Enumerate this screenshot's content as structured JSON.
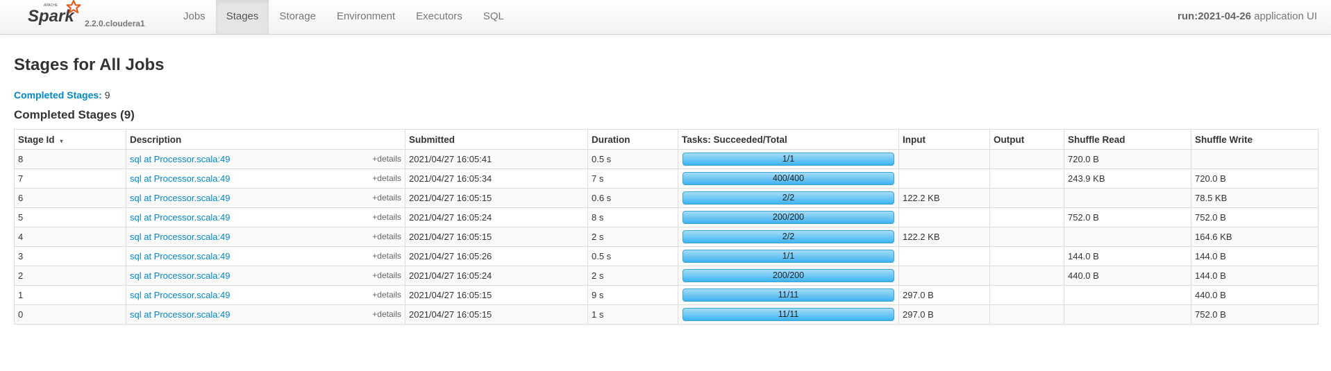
{
  "brand": {
    "logo_text": "Spark",
    "logo_small_text": "APACHE",
    "version": "2.2.0.cloudera1"
  },
  "nav": {
    "tabs": [
      {
        "label": "Jobs",
        "active": false
      },
      {
        "label": "Stages",
        "active": true
      },
      {
        "label": "Storage",
        "active": false
      },
      {
        "label": "Environment",
        "active": false
      },
      {
        "label": "Executors",
        "active": false
      },
      {
        "label": "SQL",
        "active": false
      }
    ]
  },
  "app": {
    "name": "run:2021-04-26",
    "suffix": "application UI"
  },
  "page": {
    "title": "Stages for All Jobs",
    "summary_label": "Completed Stages:",
    "summary_value": "9",
    "section_title": "Completed Stages (9)"
  },
  "table": {
    "columns": [
      "Stage Id",
      "Description",
      "Submitted",
      "Duration",
      "Tasks: Succeeded/Total",
      "Input",
      "Output",
      "Shuffle Read",
      "Shuffle Write"
    ],
    "sort_indicator": "▾",
    "details_label": "+details",
    "rows": [
      {
        "id": "8",
        "desc": "sql at Processor.scala:49",
        "submitted": "2021/04/27 16:05:41",
        "duration": "0.5 s",
        "tasks": "1/1",
        "progress": 1.0,
        "input": "",
        "output": "",
        "shuffle_read": "720.0 B",
        "shuffle_write": ""
      },
      {
        "id": "7",
        "desc": "sql at Processor.scala:49",
        "submitted": "2021/04/27 16:05:34",
        "duration": "7 s",
        "tasks": "400/400",
        "progress": 1.0,
        "input": "",
        "output": "",
        "shuffle_read": "243.9 KB",
        "shuffle_write": "720.0 B"
      },
      {
        "id": "6",
        "desc": "sql at Processor.scala:49",
        "submitted": "2021/04/27 16:05:15",
        "duration": "0.6 s",
        "tasks": "2/2",
        "progress": 1.0,
        "input": "122.2 KB",
        "output": "",
        "shuffle_read": "",
        "shuffle_write": "78.5 KB"
      },
      {
        "id": "5",
        "desc": "sql at Processor.scala:49",
        "submitted": "2021/04/27 16:05:24",
        "duration": "8 s",
        "tasks": "200/200",
        "progress": 1.0,
        "input": "",
        "output": "",
        "shuffle_read": "752.0 B",
        "shuffle_write": "752.0 B"
      },
      {
        "id": "4",
        "desc": "sql at Processor.scala:49",
        "submitted": "2021/04/27 16:05:15",
        "duration": "2 s",
        "tasks": "2/2",
        "progress": 1.0,
        "input": "122.2 KB",
        "output": "",
        "shuffle_read": "",
        "shuffle_write": "164.6 KB"
      },
      {
        "id": "3",
        "desc": "sql at Processor.scala:49",
        "submitted": "2021/04/27 16:05:26",
        "duration": "0.5 s",
        "tasks": "1/1",
        "progress": 1.0,
        "input": "",
        "output": "",
        "shuffle_read": "144.0 B",
        "shuffle_write": "144.0 B"
      },
      {
        "id": "2",
        "desc": "sql at Processor.scala:49",
        "submitted": "2021/04/27 16:05:24",
        "duration": "2 s",
        "tasks": "200/200",
        "progress": 1.0,
        "input": "",
        "output": "",
        "shuffle_read": "440.0 B",
        "shuffle_write": "144.0 B"
      },
      {
        "id": "1",
        "desc": "sql at Processor.scala:49",
        "submitted": "2021/04/27 16:05:15",
        "duration": "9 s",
        "tasks": "11/11",
        "progress": 1.0,
        "input": "297.0 B",
        "output": "",
        "shuffle_read": "",
        "shuffle_write": "440.0 B"
      },
      {
        "id": "0",
        "desc": "sql at Processor.scala:49",
        "submitted": "2021/04/27 16:05:15",
        "duration": "1 s",
        "tasks": "11/11",
        "progress": 1.0,
        "input": "297.0 B",
        "output": "",
        "shuffle_read": "",
        "shuffle_write": "752.0 B"
      }
    ]
  },
  "colors": {
    "link": "#0088cc",
    "progress": "#3eb3ef",
    "logo_star": "#e25a1c"
  }
}
